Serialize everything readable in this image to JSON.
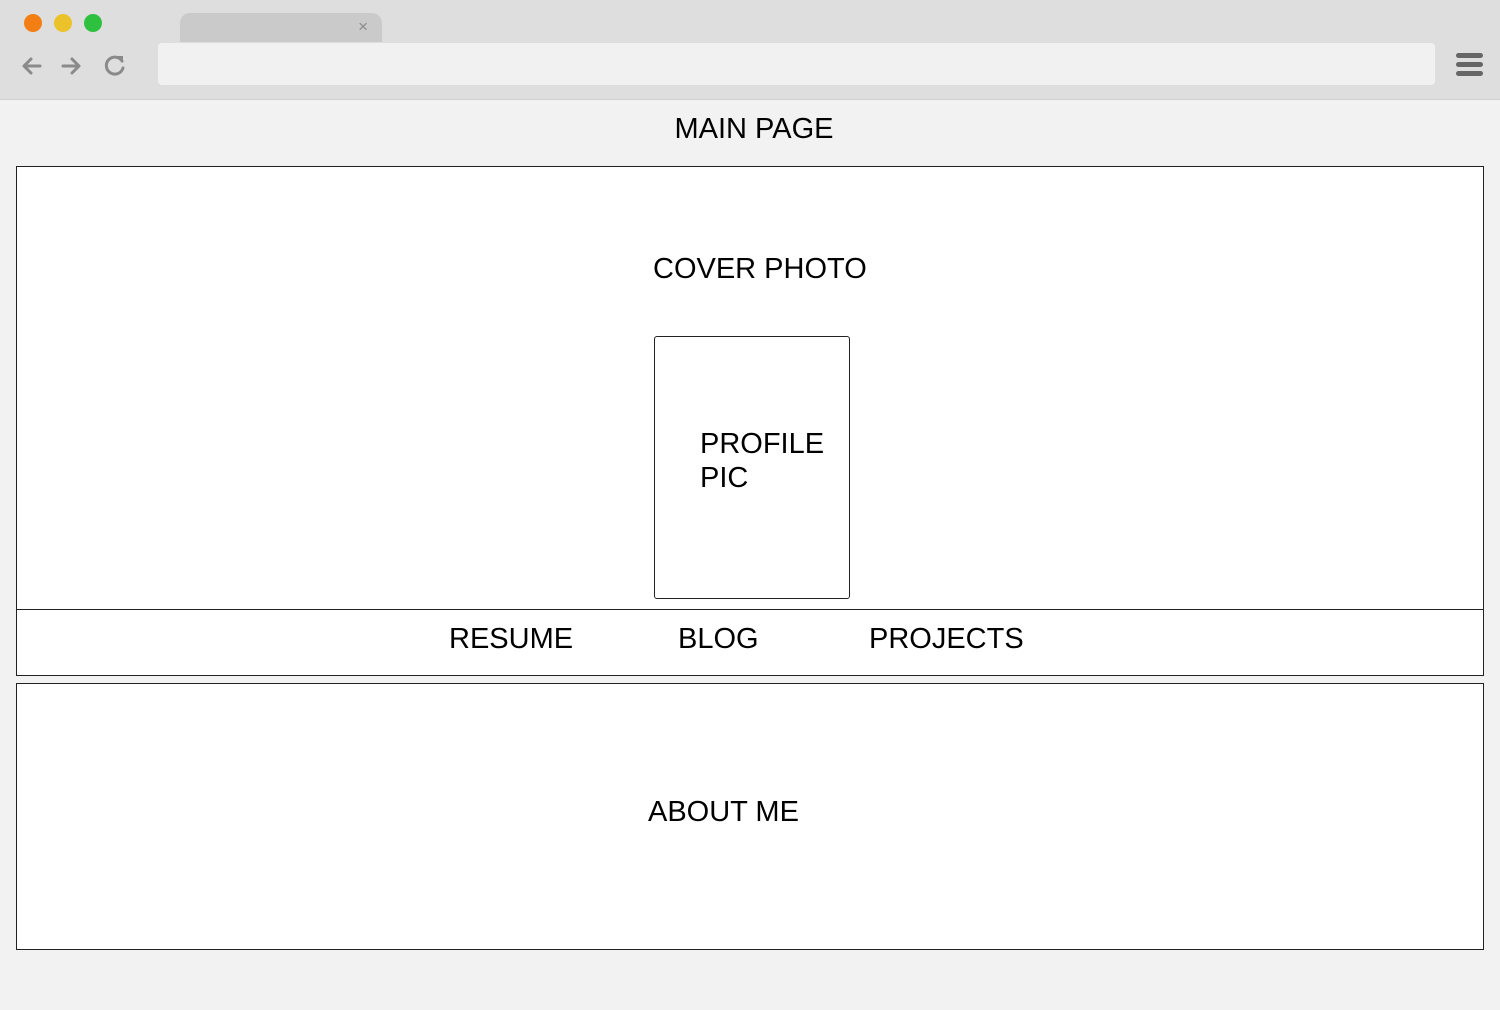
{
  "browser": {
    "tab": {
      "title": "",
      "close_glyph": "×"
    },
    "address_bar": {
      "value": "",
      "placeholder": ""
    },
    "traffic_lights": {
      "close_color": "#f37e14",
      "minimize_color": "#ecc22b",
      "maximize_color": "#2ec13f"
    },
    "icons": {
      "back": "arrow-left-icon",
      "forward": "arrow-right-icon",
      "reload": "reload-icon",
      "menu": "hamburger-menu-icon"
    }
  },
  "page": {
    "title": "MAIN PAGE",
    "hero": {
      "cover_label": "COVER PHOTO",
      "profile_label_line1": "PROFILE",
      "profile_label_line2": "PIC"
    },
    "nav": {
      "items": [
        {
          "label": "RESUME"
        },
        {
          "label": "BLOG"
        },
        {
          "label": "PROJECTS"
        }
      ]
    },
    "about": {
      "label": "ABOUT ME"
    }
  }
}
